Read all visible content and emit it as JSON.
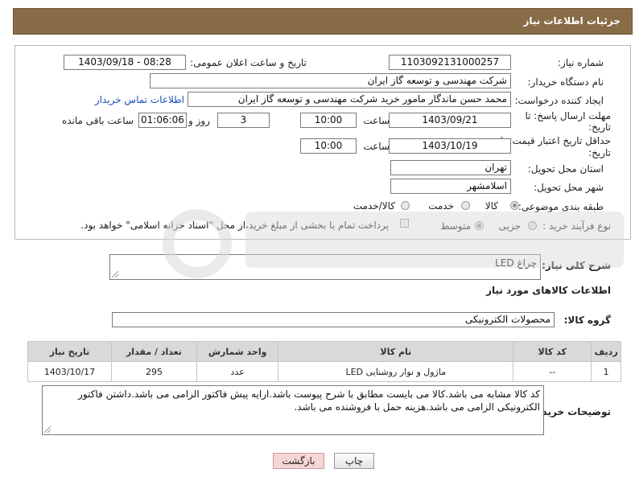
{
  "header": {
    "title": "جزئیات اطلاعات نیاز"
  },
  "fields": {
    "need_number_label": "شماره نیاز:",
    "need_number": "1103092131000257",
    "announce_label": "تاریخ و ساعت اعلان عمومی:",
    "announce_value": "1403/09/18 - 08:28",
    "buyer_org_label": "نام دستگاه خریدار:",
    "buyer_org": "شرکت مهندسی و توسعه گاز ایران",
    "creator_label": "ایجاد کننده درخواست:",
    "creator": "محمد حسن ماندگار مامور خرید شرکت مهندسی و توسعه گاز ایران",
    "contact_link": "اطلاعات تماس خریدار",
    "reply_deadline_label_1": "مهلت ارسال پاسخ: تا",
    "reply_deadline_label_2": "تاریخ:",
    "reply_date": "1403/09/21",
    "time_label": "ساعت",
    "reply_time": "10:00",
    "days": "3",
    "days_label": "روز و",
    "remaining": "01:06:06",
    "remaining_label": "ساعت باقی مانده",
    "price_valid_label_1": "حداقل تاریخ اعتبار قیمت: تا",
    "price_valid_label_2": "تاریخ:",
    "price_valid_date": "1403/10/19",
    "price_valid_time": "10:00",
    "province_label": "استان محل تحویل:",
    "province": "تهران",
    "city_label": "شهر محل تحویل:",
    "city": "اسلامشهر",
    "category_label": "طبقه بندی موضوعی:",
    "category_options": [
      "کالا",
      "خدمت",
      "کالا/خدمت"
    ],
    "process_label": "نوع فرآیند خرید :",
    "process_options": [
      "جزیی",
      "متوسط"
    ],
    "payment_note": "پرداخت تمام یا بخشی از مبلغ خرید،از محل \"اسناد خزانه اسلامی\" خواهد بود."
  },
  "summary": {
    "label": "شرح کلی نیاز:",
    "value": "چراغ LED"
  },
  "goods_section_title": "اطلاعات کالاهای مورد نیاز",
  "group": {
    "label": "گروه کالا:",
    "value": "محصولات الکترونیکی"
  },
  "table": {
    "headers": [
      "ردیف",
      "کد کالا",
      "نام کالا",
      "واحد شمارش",
      "تعداد / مقدار",
      "تاریخ نیاز"
    ],
    "rows": [
      [
        "1",
        "--",
        "ماژول و نوار روشنایی LED",
        "عدد",
        "295",
        "1403/10/17"
      ]
    ]
  },
  "buyer_notes": {
    "label": "توضیحات خریدار:",
    "value": "کد کالا مشابه می باشد.کالا می بایست مطابق با شرح پیوست باشد.ارایه پیش فاکتور الزامی می باشد.داشتن فاکتور الکترونیکی الزامی می باشد.هزینه حمل با فروشنده می باشد."
  },
  "buttons": {
    "print": "چاپ",
    "back": "بازگشت"
  },
  "colors": {
    "header_bg": "#886b47",
    "link": "#1a4fb8",
    "back_btn_bg": "#f6d6d6"
  }
}
